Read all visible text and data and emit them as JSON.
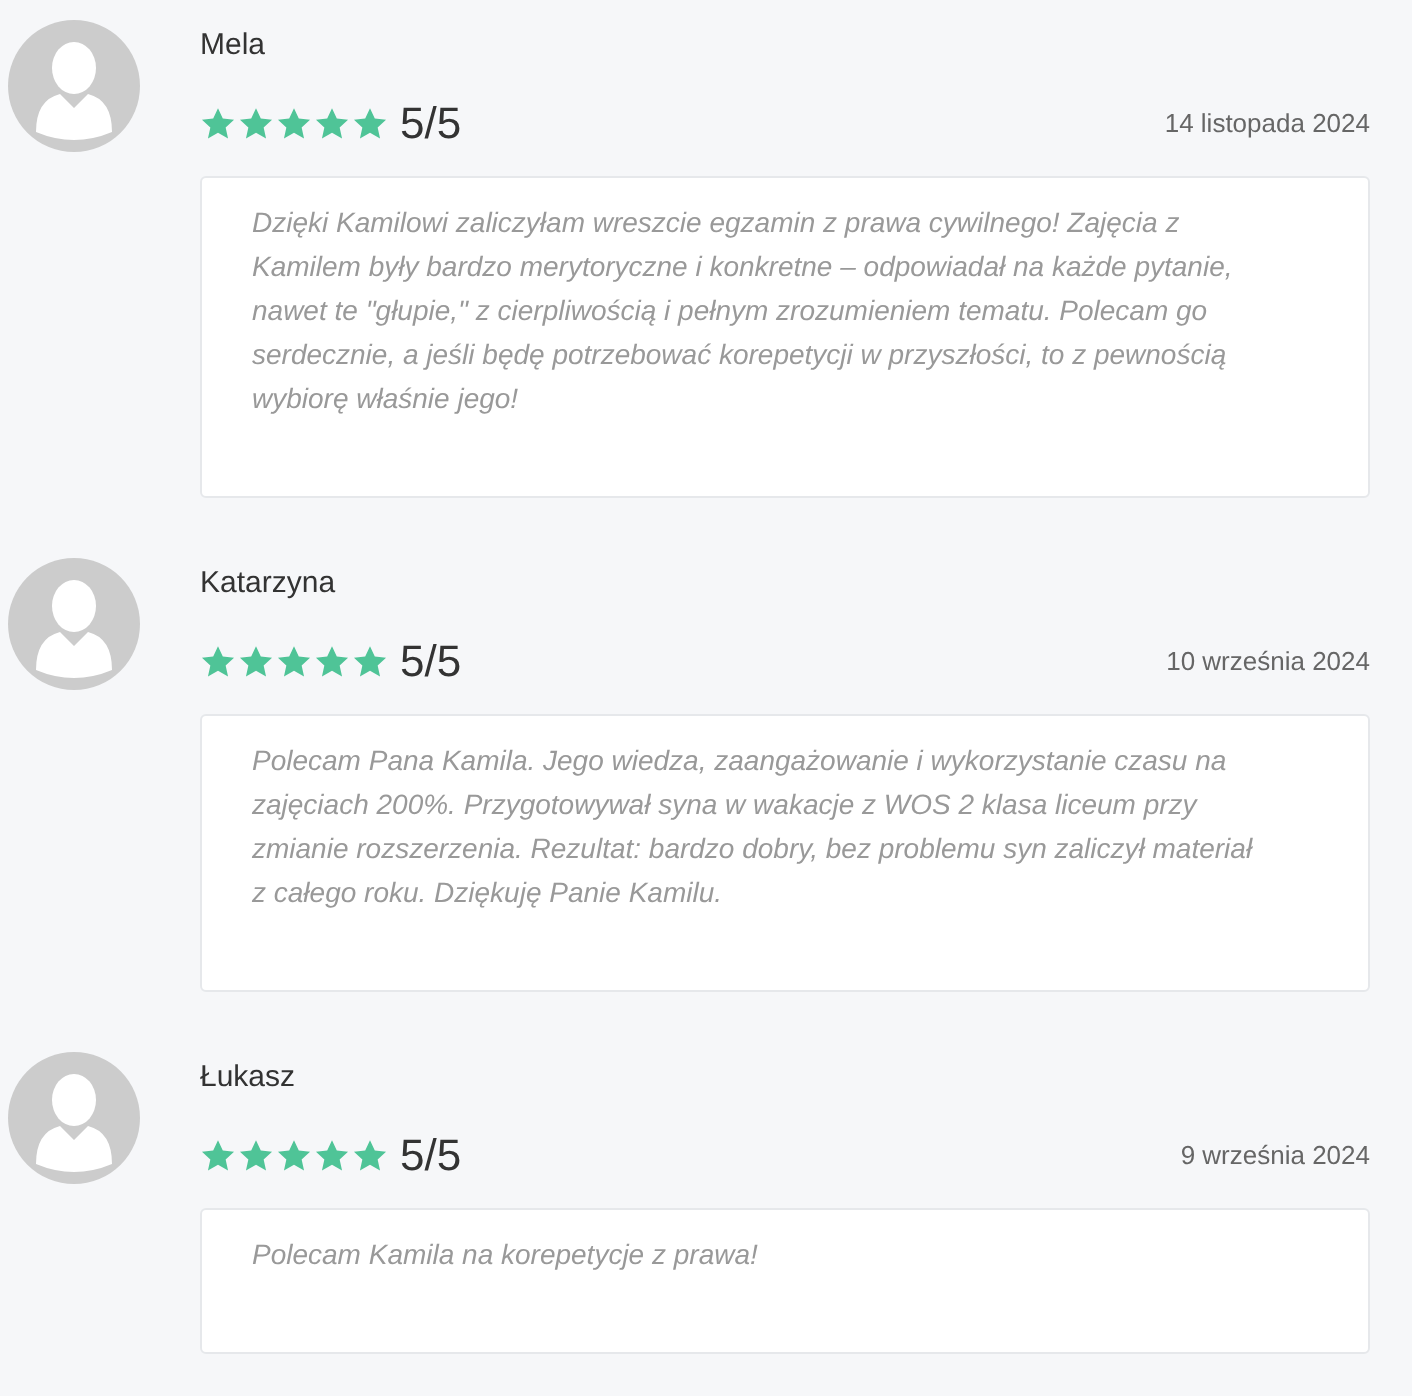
{
  "reviews": [
    {
      "name": "Mela",
      "stars": 5,
      "score": "5/5",
      "date": "14 listopada 2024",
      "text": "Dzięki Kamilowi zaliczyłam wreszcie egzamin z prawa cywilnego! Zajęcia z Kamilem były bardzo merytoryczne i konkretne – odpowiadał na każde pytanie, nawet te \"głupie,\" z cierpliwością i pełnym zrozumieniem tematu. Polecam go serdecznie, a jeśli będę potrzebować korepetycji w przyszłości, to z pewnością wybiorę właśnie jego!"
    },
    {
      "name": "Katarzyna",
      "stars": 5,
      "score": "5/5",
      "date": "10 września 2024",
      "text": "Polecam Pana Kamila. Jego wiedza, zaangażowanie i wykorzystanie czasu na zajęciach 200%. Przygotowywał syna w wakacje z WOS 2 klasa liceum przy zmianie rozszerzenia. Rezultat: bardzo dobry, bez problemu syn zaliczył materiał z całego roku. Dziękuję Panie Kamilu."
    },
    {
      "name": "Łukasz",
      "stars": 5,
      "score": "5/5",
      "date": "9 września 2024",
      "text": "Polecam Kamila na korepetycje z prawa!"
    }
  ]
}
